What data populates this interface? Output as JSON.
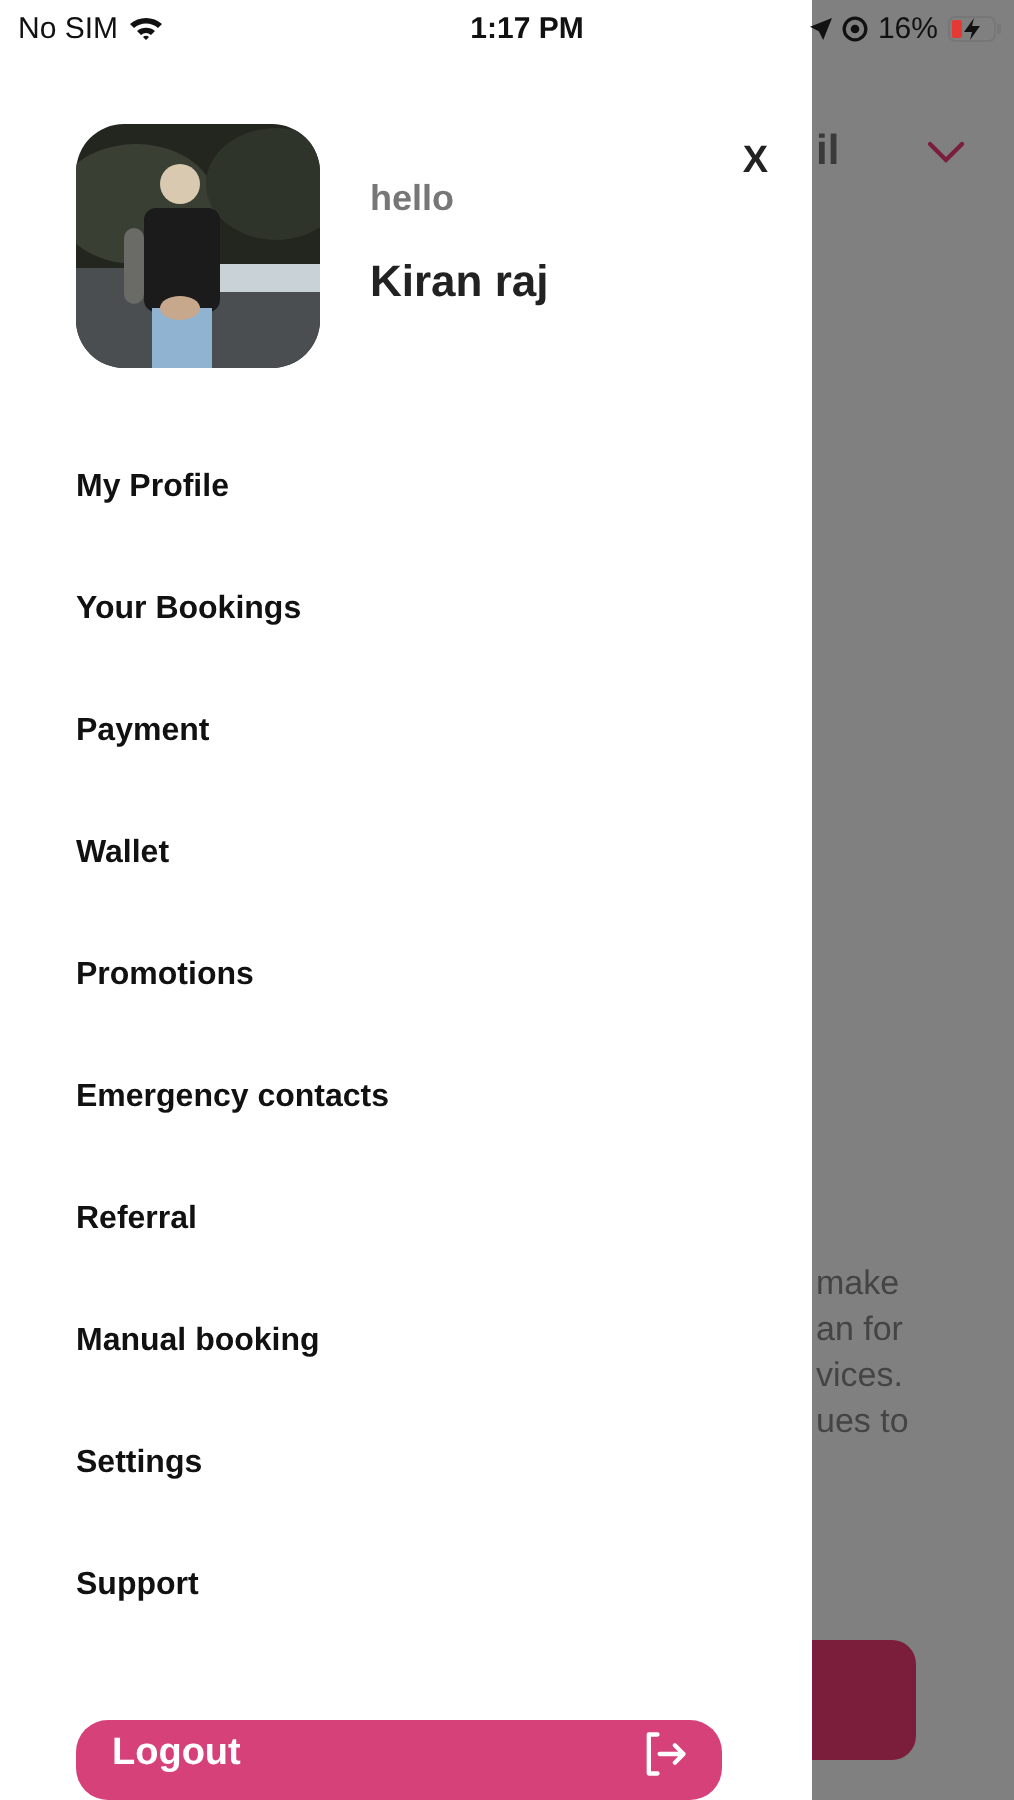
{
  "status_bar": {
    "carrier": "No SIM",
    "time": "1:17 PM",
    "battery": "16%"
  },
  "drawer": {
    "greeting": "hello",
    "name": "Kiran raj",
    "close": "X",
    "menu": [
      {
        "label": "My Profile"
      },
      {
        "label": "Your Bookings"
      },
      {
        "label": "Payment"
      },
      {
        "label": "Wallet"
      },
      {
        "label": "Promotions"
      },
      {
        "label": "Emergency contacts"
      },
      {
        "label": "Referral"
      },
      {
        "label": "Manual booking"
      },
      {
        "label": "Settings"
      },
      {
        "label": "Support"
      }
    ],
    "logout": "Logout"
  },
  "background": {
    "title": "il",
    "text_lines": [
      "make",
      "an for",
      "vices.",
      "ues to"
    ]
  }
}
